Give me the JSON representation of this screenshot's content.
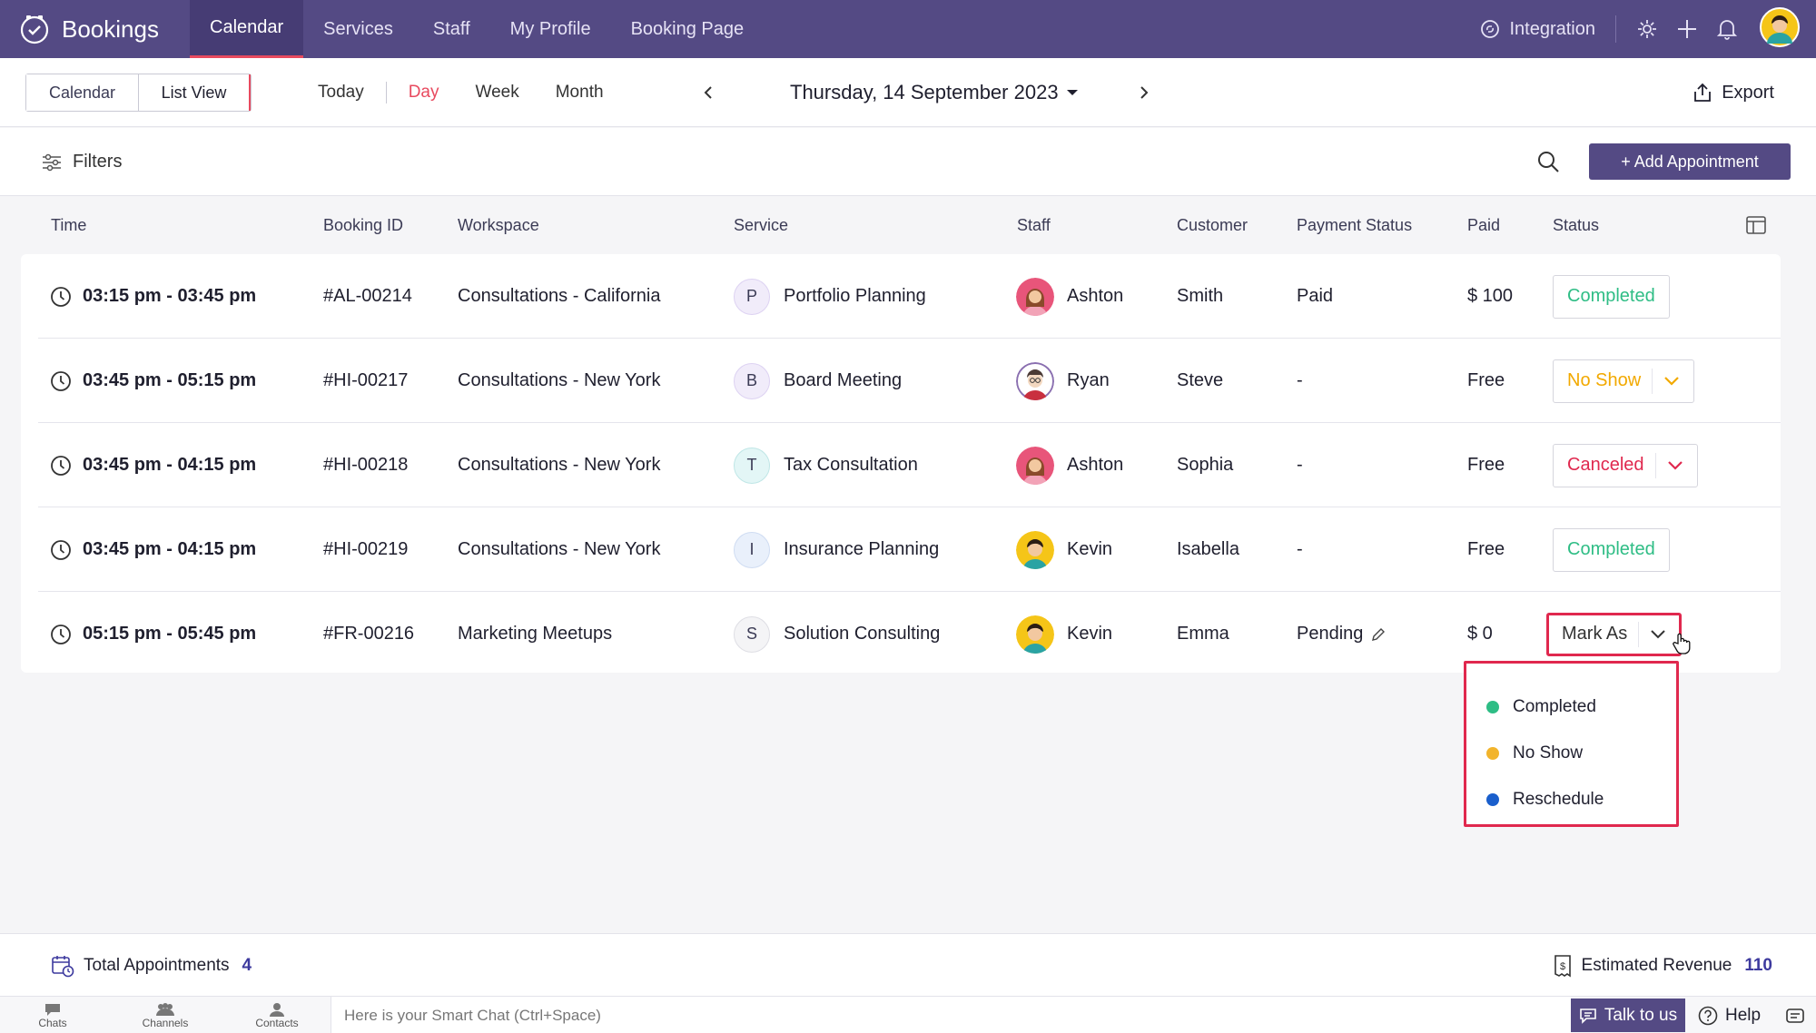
{
  "app": {
    "name": "Bookings"
  },
  "nav": {
    "tabs": [
      "Calendar",
      "Services",
      "Staff",
      "My Profile",
      "Booking Page"
    ],
    "active": "Calendar",
    "integration_label": "Integration"
  },
  "toolbar": {
    "view_calendar": "Calendar",
    "view_list": "List View",
    "today": "Today",
    "day": "Day",
    "week": "Week",
    "month": "Month",
    "date": "Thursday, 14 September 2023",
    "export": "Export"
  },
  "filterbar": {
    "filters": "Filters",
    "add_appointment": "+ Add Appointment"
  },
  "columns": [
    "Time",
    "Booking ID",
    "Workspace",
    "Service",
    "Staff",
    "Customer",
    "Payment Status",
    "Paid",
    "Status"
  ],
  "rows": [
    {
      "time": "03:15 pm - 03:45 pm",
      "booking_id": "#AL-00214",
      "workspace": "Consultations - California",
      "service_initial": "P",
      "service": "Portfolio Planning",
      "staff": "Ashton",
      "customer": "Smith",
      "payment_status": "Paid",
      "paid": "$ 100",
      "status": "Completed"
    },
    {
      "time": "03:45 pm - 05:15 pm",
      "booking_id": "#HI-00217",
      "workspace": "Consultations - New York",
      "service_initial": "B",
      "service": "Board Meeting",
      "staff": "Ryan",
      "customer": "Steve",
      "payment_status": "-",
      "paid": "Free",
      "status": "No Show"
    },
    {
      "time": "03:45 pm - 04:15 pm",
      "booking_id": "#HI-00218",
      "workspace": "Consultations - New York",
      "service_initial": "T",
      "service": "Tax Consultation",
      "staff": "Ashton",
      "customer": "Sophia",
      "payment_status": "-",
      "paid": "Free",
      "status": "Canceled"
    },
    {
      "time": "03:45 pm - 04:15 pm",
      "booking_id": "#HI-00219",
      "workspace": "Consultations - New York",
      "service_initial": "I",
      "service": "Insurance Planning",
      "staff": "Kevin",
      "customer": "Isabella",
      "payment_status": "-",
      "paid": "Free",
      "status": "Completed"
    },
    {
      "time": "05:15 pm - 05:45 pm",
      "booking_id": "#FR-00216",
      "workspace": "Marketing Meetups",
      "service_initial": "S",
      "service": "Solution Consulting",
      "staff": "Kevin",
      "customer": "Emma",
      "payment_status": "Pending",
      "paid": "$ 0",
      "status": "Mark As"
    }
  ],
  "dropdown": {
    "items": [
      {
        "label": "Completed",
        "color": "#2ebd85"
      },
      {
        "label": "No Show",
        "color": "#f2b42c"
      },
      {
        "label": "Reschedule",
        "color": "#1a5fcc"
      }
    ]
  },
  "footer": {
    "total_label": "Total Appointments",
    "total_count": "4",
    "revenue_label": "Estimated Revenue",
    "revenue_value": "110"
  },
  "bottombar": {
    "chats": "Chats",
    "channels": "Channels",
    "contacts": "Contacts",
    "smartchat_placeholder": "Here is your Smart Chat (Ctrl+Space)",
    "talk": "Talk to us",
    "help": "Help"
  },
  "colors": {
    "brand": "#544a84",
    "accent": "#e84a5f",
    "completed": "#2ebd85",
    "noshow": "#f2a900",
    "canceled": "#e0284e"
  }
}
